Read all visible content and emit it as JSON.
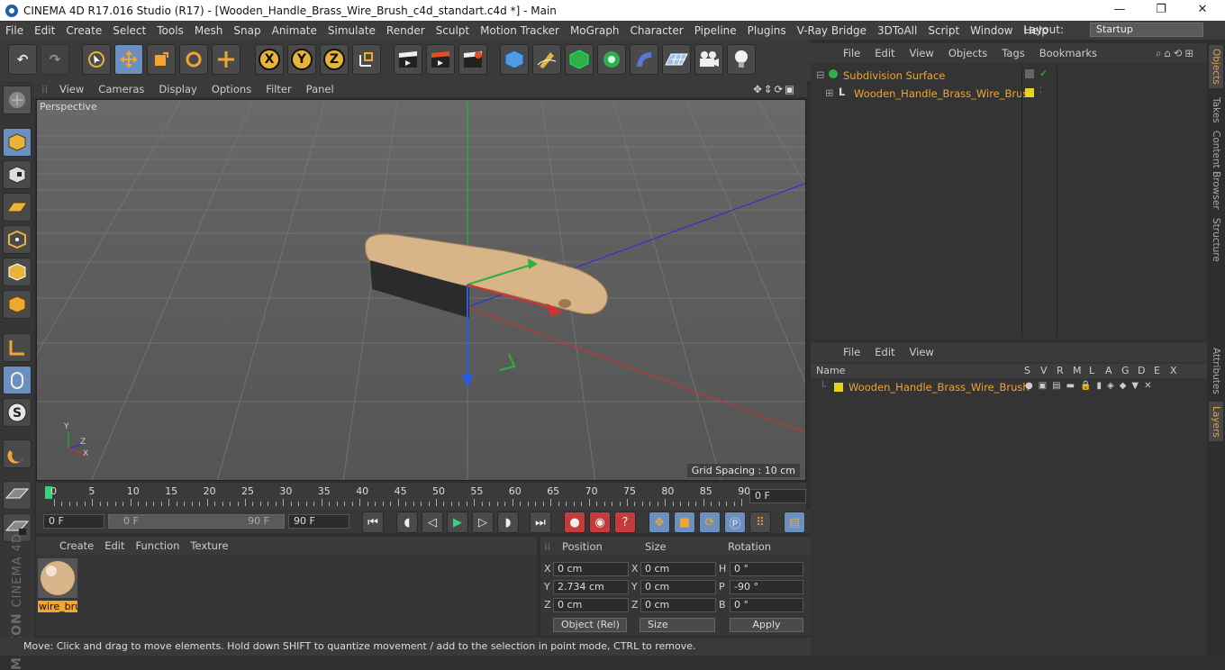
{
  "window": {
    "title": "CINEMA 4D R17.016 Studio (R17) - [Wooden_Handle_Brass_Wire_Brush_c4d_standart.c4d *] - Main",
    "minimize": "—",
    "maximize": "❐",
    "close": "✕"
  },
  "menu": [
    "File",
    "Edit",
    "Create",
    "Select",
    "Tools",
    "Mesh",
    "Snap",
    "Animate",
    "Simulate",
    "Render",
    "Sculpt",
    "Motion Tracker",
    "MoGraph",
    "Character",
    "Pipeline",
    "Plugins",
    "V-Ray Bridge",
    "3DToAll",
    "Script",
    "Window",
    "Help"
  ],
  "layout": {
    "label": "Layout:",
    "value": "Startup"
  },
  "toolbar": {
    "undo": "↶",
    "redo": "↷",
    "x": "X",
    "y": "Y",
    "z": "Z"
  },
  "viewport": {
    "menu": [
      "View",
      "Cameras",
      "Display",
      "Options",
      "Filter",
      "Panel"
    ],
    "label": "Perspective",
    "grid_spacing": "Grid Spacing : 10 cm",
    "axis_y": "Y",
    "axis_z": "Z",
    "axis_x": "X"
  },
  "timeline": {
    "ticks": [
      "0",
      "5",
      "10",
      "15",
      "20",
      "25",
      "30",
      "35",
      "40",
      "45",
      "50",
      "55",
      "60",
      "65",
      "70",
      "75",
      "80",
      "85",
      "90"
    ],
    "end_field": "0 F"
  },
  "playback": {
    "start": "0 F",
    "range_start": "0 F",
    "range_end": "90 F",
    "end": "90 F"
  },
  "materials": {
    "menu": [
      "Create",
      "Edit",
      "Function",
      "Texture"
    ],
    "item": "wire_bru"
  },
  "coords": {
    "headers": {
      "position": "Position",
      "size": "Size",
      "rotation": "Rotation"
    },
    "rows": [
      {
        "a1": "X",
        "v1": "0 cm",
        "a2": "X",
        "v2": "0 cm",
        "a3": "H",
        "v3": "0 °"
      },
      {
        "a1": "Y",
        "v1": "2.734 cm",
        "a2": "Y",
        "v2": "0 cm",
        "a3": "P",
        "v3": "-90 °"
      },
      {
        "a1": "Z",
        "v1": "0 cm",
        "a2": "Z",
        "v2": "0 cm",
        "a3": "B",
        "v3": "0 °"
      }
    ],
    "mode": "Object (Rel)",
    "size_mode": "Size",
    "apply": "Apply"
  },
  "status": "Move: Click and drag to move elements. Hold down SHIFT to quantize movement / add to the selection in point mode, CTRL to remove.",
  "objects": {
    "menu": [
      "File",
      "Edit",
      "View",
      "Objects",
      "Tags",
      "Bookmarks"
    ],
    "items": [
      "Subdivision Surface",
      "Wooden_Handle_Brass_Wire_Brush"
    ]
  },
  "layers": {
    "menu": [
      "File",
      "Edit",
      "View"
    ],
    "name_header": "Name",
    "cols": [
      "S",
      "V",
      "R",
      "M",
      "L",
      "A",
      "G",
      "D",
      "E",
      "X"
    ],
    "item": "Wooden_Handle_Brass_Wire_Brush"
  },
  "sidetabs": [
    "Objects",
    "Takes",
    "Content Browser",
    "Structure",
    "Attributes",
    "Layers"
  ],
  "brand": {
    "maxon": "MAXON",
    "product": "CINEMA 4D"
  },
  "colors": {
    "accent": "#f0a630",
    "active_tool": "#6b8fbf",
    "layer": "#e8d21f"
  }
}
